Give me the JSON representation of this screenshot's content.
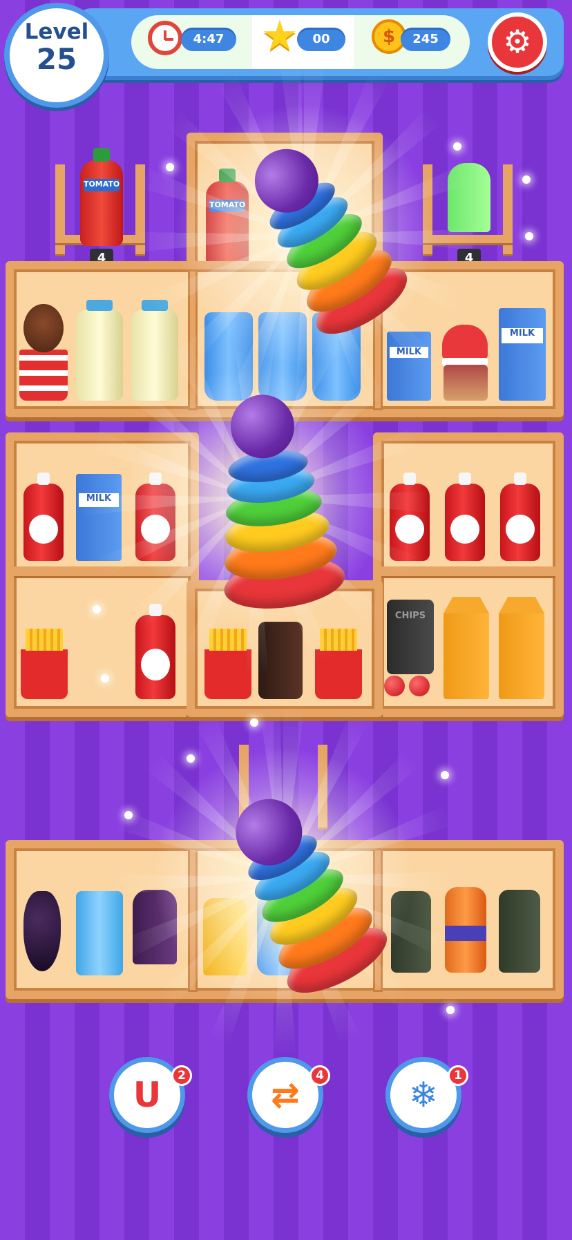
{
  "hud": {
    "level_label": "Level",
    "level_number": "25",
    "timer": "4:47",
    "stars": "00",
    "coins": "245",
    "settings_icon": "gear-icon"
  },
  "shelves": {
    "top_left_count": "4",
    "top_right_count": "4",
    "labels": {
      "tomato": "TOMATO",
      "milk": "MILK",
      "chips": "CHIPS"
    }
  },
  "powerups": [
    {
      "name": "magnet",
      "icon": "magnet-icon",
      "count": "2"
    },
    {
      "name": "shuffle",
      "icon": "shuffle-icon",
      "count": "4"
    },
    {
      "name": "freeze",
      "icon": "snowflake-clock-icon",
      "count": "1"
    }
  ],
  "colors": {
    "ring_colors": [
      "#e8363a",
      "#ff7a1a",
      "#ffcb1f",
      "#4fcf3a",
      "#3aa9f2",
      "#2f72e0"
    ],
    "top_ball": "#7b3ac4",
    "background": "#8a3fe0",
    "hud_blue": "#5aa6f2"
  }
}
